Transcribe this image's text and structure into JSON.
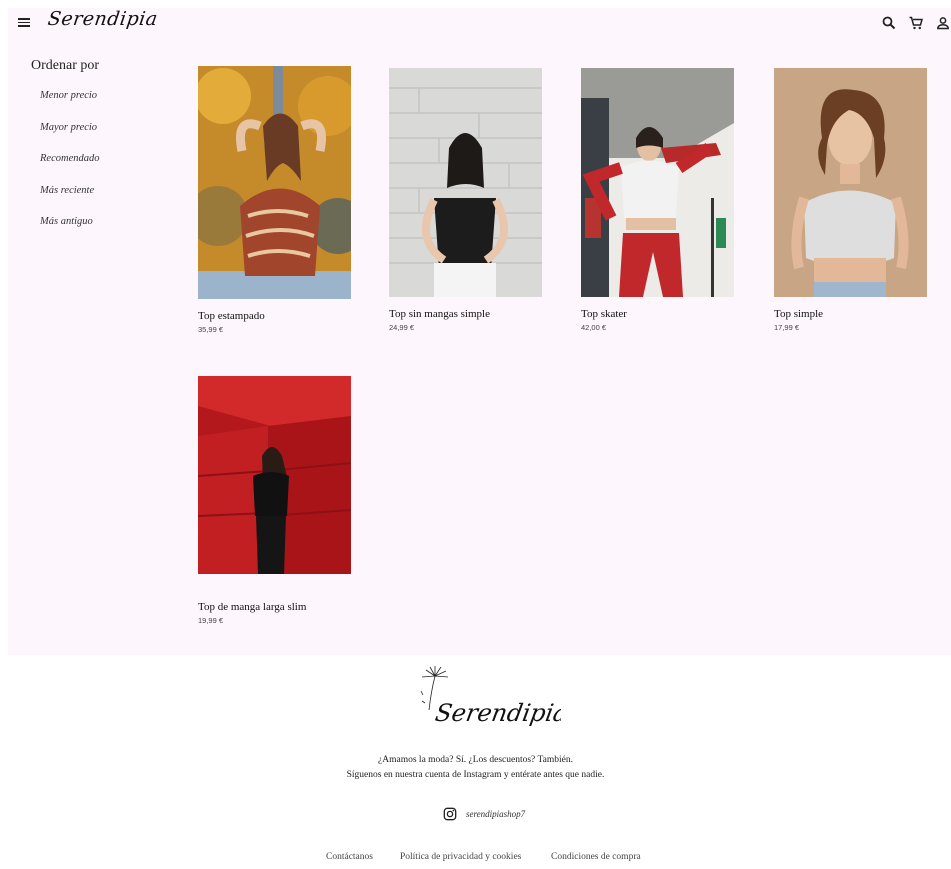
{
  "brand": {
    "name": "Serendipia"
  },
  "header": {
    "icons": [
      "menu-icon",
      "search-icon",
      "cart-icon",
      "user-icon"
    ]
  },
  "sidebar": {
    "title": "Ordenar por",
    "items": [
      {
        "label": "Menor precio"
      },
      {
        "label": "Mayor precio"
      },
      {
        "label": "Recomendado"
      },
      {
        "label": "Más reciente"
      },
      {
        "label": "Más antiguo"
      }
    ]
  },
  "products": [
    {
      "name": "Top estampado",
      "price": "35,99 €"
    },
    {
      "name": "Top sin mangas simple",
      "price": "24,99 €"
    },
    {
      "name": "Top skater",
      "price": "42,00 €"
    },
    {
      "name": "Top simple",
      "price": "17,99 €"
    },
    {
      "name": "Top de manga larga slim",
      "price": "19,99 €"
    }
  ],
  "footer": {
    "tagline_1": "¿Amamos la moda? Sí. ¿Los descuentos? También.",
    "tagline_2": "Síguenos en nuestra cuenta de Instagram y entérate antes que nadie.",
    "instagram_handle": "serendipiashop7",
    "links": [
      {
        "label": "Contáctanos"
      },
      {
        "label": "Política de privacidad y cookies"
      },
      {
        "label": "Condiciones de compra"
      }
    ]
  },
  "colors": {
    "main_background": "#fdf6fc",
    "footer_background": "#ffffff",
    "text": "#222222"
  }
}
